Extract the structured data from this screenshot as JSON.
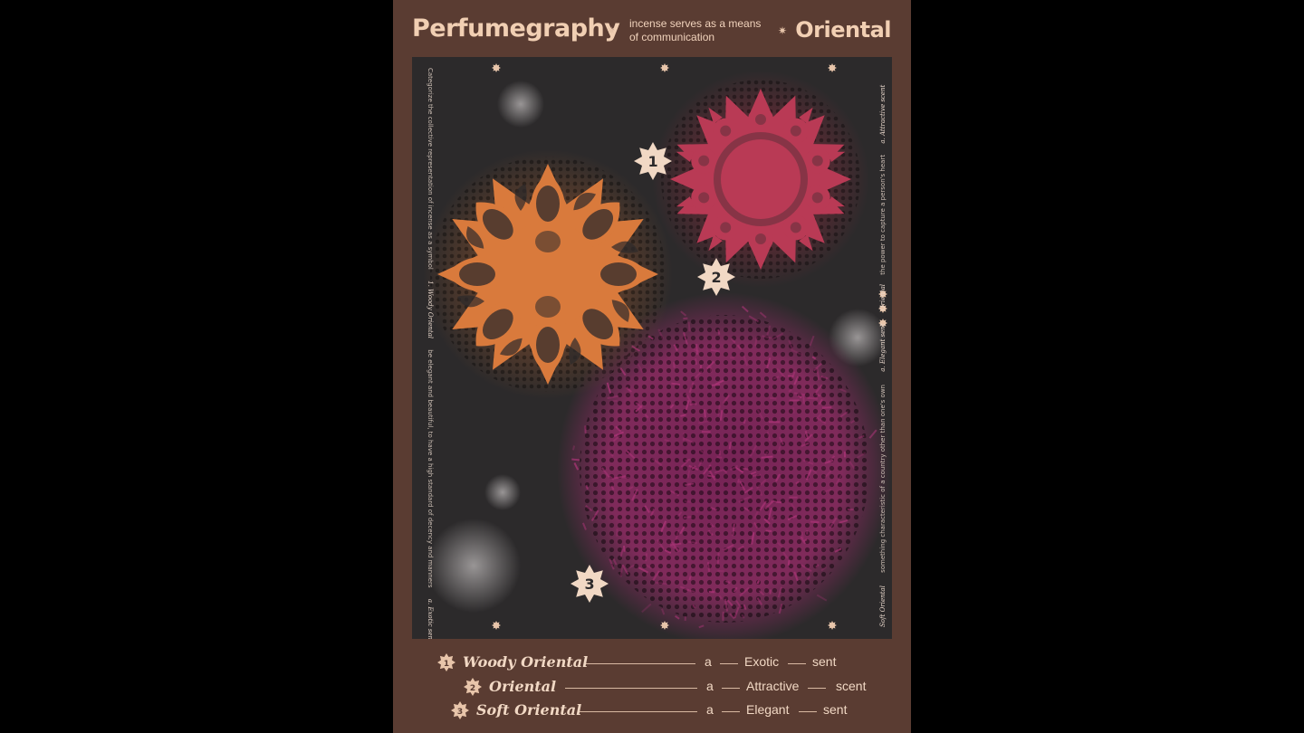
{
  "header": {
    "title": "Perfumegraphy",
    "subtitle_line1": "incense serves as a means",
    "subtitle_line2": "of communication",
    "right_title": "Oriental"
  },
  "artwork": {
    "badges": [
      "1",
      "2",
      "3"
    ],
    "left_side_text": "Categorize the collective representation of incense as a symbol",
    "left_side_sig": "1. Woody Oriental",
    "left_side_text2": "be elegant and beautiful, to have a high standard of decency and manners",
    "left_side_sig2": "a. Exotic sent",
    "right_side_text": "the power to capture a person's heart",
    "right_side_sig": "a. Attractive scent",
    "right_side_sig0": "Oriental",
    "right_side_text2": "something characteristic of a country other than one's own",
    "right_side_sig2": "a. Elegant sent",
    "right_side_sig3": "Soft Oriental",
    "colors": {
      "orange": "#d97a3c",
      "crimson": "#b93a55",
      "magenta": "#8e2a63",
      "background": "#2c2a2b"
    }
  },
  "legend": {
    "rows": [
      {
        "badge": "1",
        "name": "Woody Oriental",
        "article": "a",
        "quality": "Exotic",
        "noun": "sent"
      },
      {
        "badge": "2",
        "name": "Oriental",
        "article": "a",
        "quality": "Attractive",
        "noun": "scent"
      },
      {
        "badge": "3",
        "name": "Soft Oriental",
        "article": "a",
        "quality": "Elegant",
        "noun": "sent"
      }
    ]
  }
}
